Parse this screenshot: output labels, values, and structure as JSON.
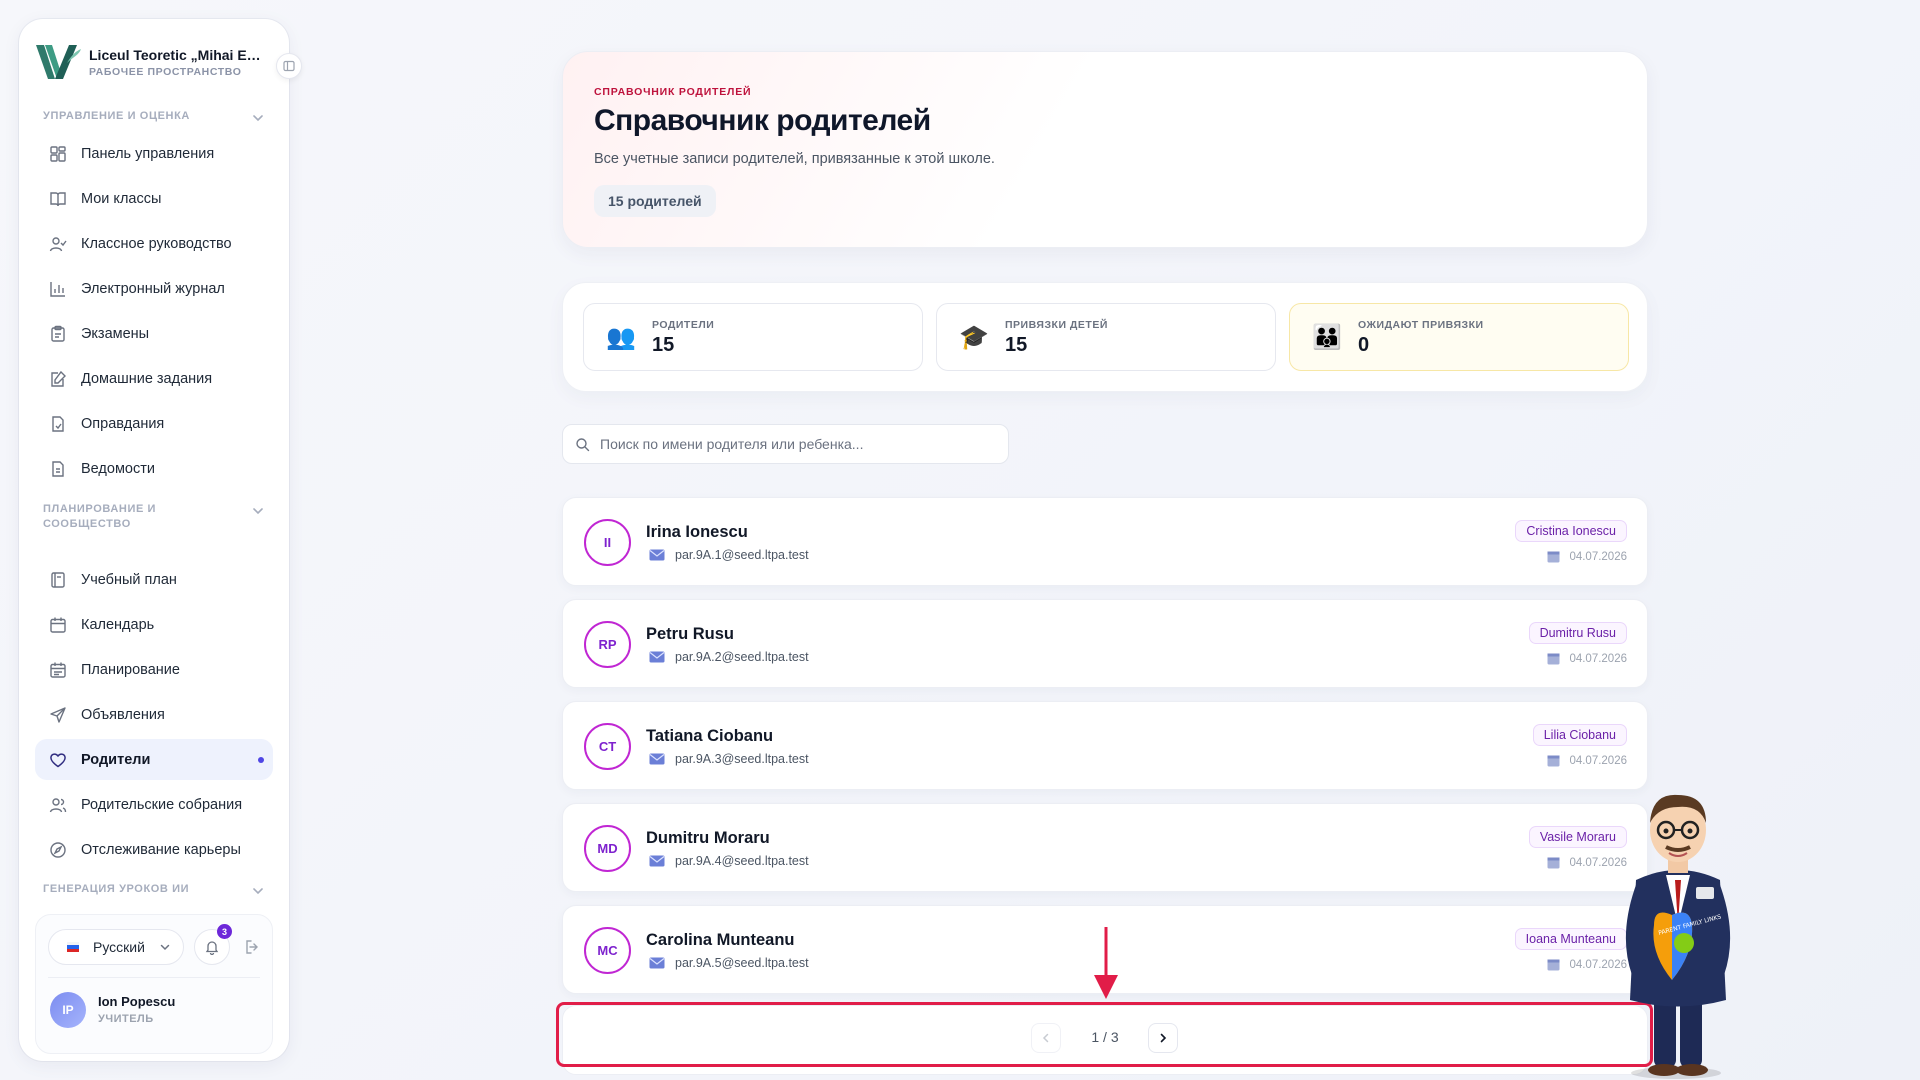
{
  "brand": {
    "name": "Liceul Teoretic „Mihai Emi...",
    "subtitle": "РАБОЧЕЕ ПРОСТРАНСТВО"
  },
  "sidebar": {
    "sections": [
      {
        "title": "УПРАВЛЕНИЕ И ОЦЕНКА",
        "items": [
          {
            "label": "Панель управления",
            "icon": "dashboard-icon"
          },
          {
            "label": "Мои классы",
            "icon": "book-icon"
          },
          {
            "label": "Классное руководство",
            "icon": "user-check-icon"
          },
          {
            "label": "Электронный журнал",
            "icon": "bar-chart-icon"
          },
          {
            "label": "Экзамены",
            "icon": "clipboard-icon"
          },
          {
            "label": "Домашние задания",
            "icon": "edit-note-icon"
          },
          {
            "label": "Оправдания",
            "icon": "file-check-icon"
          },
          {
            "label": "Ведомости",
            "icon": "file-text-icon"
          }
        ]
      },
      {
        "title": "ПЛАНИРОВАНИЕ И СООБЩЕСТВО",
        "items": [
          {
            "label": "Учебный план",
            "icon": "notebook-icon"
          },
          {
            "label": "Календарь",
            "icon": "calendar-icon"
          },
          {
            "label": "Планирование",
            "icon": "calendar-grid-icon"
          },
          {
            "label": "Объявления",
            "icon": "send-icon"
          },
          {
            "label": "Родители",
            "icon": "heart-icon",
            "active": true
          },
          {
            "label": "Родительские собрания",
            "icon": "users-icon"
          },
          {
            "label": "Отслеживание карьеры",
            "icon": "compass-icon"
          }
        ]
      },
      {
        "title": "ГЕНЕРАЦИЯ УРОКОВ ИИ",
        "items": []
      }
    ]
  },
  "footer": {
    "language": "Русский",
    "notifications_count": "3",
    "user_initials": "IP",
    "user_name": "Ion Popescu",
    "user_role": "УЧИТЕЛЬ"
  },
  "hero": {
    "eyebrow": "СПРАВОЧНИК РОДИТЕЛЕЙ",
    "title": "Справочник родителей",
    "description": "Все учетные записи родителей, привязанные к этой школе.",
    "count_chip": "15 родителей"
  },
  "stats": [
    {
      "label": "РОДИТЕЛИ",
      "value": "15",
      "icon": "parents-emoji-icon"
    },
    {
      "label": "ПРИВЯЗКИ ДЕТЕЙ",
      "value": "15",
      "icon": "graduation-cap-icon"
    },
    {
      "label": "ОЖИДАЮТ ПРИВЯЗКИ",
      "value": "0",
      "icon": "family-emoji-icon"
    }
  ],
  "search": {
    "placeholder": "Поиск по имени родителя или ребенка..."
  },
  "parents": [
    {
      "initials": "II",
      "name": "Irina Ionescu",
      "email": "par.9A.1@seed.ltpa.test",
      "child": "Cristina Ionescu",
      "date": "04.07.2026"
    },
    {
      "initials": "RP",
      "name": "Petru Rusu",
      "email": "par.9A.2@seed.ltpa.test",
      "child": "Dumitru Rusu",
      "date": "04.07.2026"
    },
    {
      "initials": "CT",
      "name": "Tatiana Ciobanu",
      "email": "par.9A.3@seed.ltpa.test",
      "child": "Lilia Ciobanu",
      "date": "04.07.2026"
    },
    {
      "initials": "MD",
      "name": "Dumitru Moraru",
      "email": "par.9A.4@seed.ltpa.test",
      "child": "Vasile Moraru",
      "date": "04.07.2026"
    },
    {
      "initials": "MC",
      "name": "Carolina Munteanu",
      "email": "par.9A.5@seed.ltpa.test",
      "child": "Ioana Munteanu",
      "date": "04.07.2026"
    }
  ],
  "pagination": {
    "text": "1 / 3"
  },
  "mascot": {
    "badge_text": "PARENT FAMILY LINKS"
  },
  "colors": {
    "accent": "#4f46e5",
    "avatar_ring": "#c026d3",
    "highlight": "#e11d48"
  }
}
